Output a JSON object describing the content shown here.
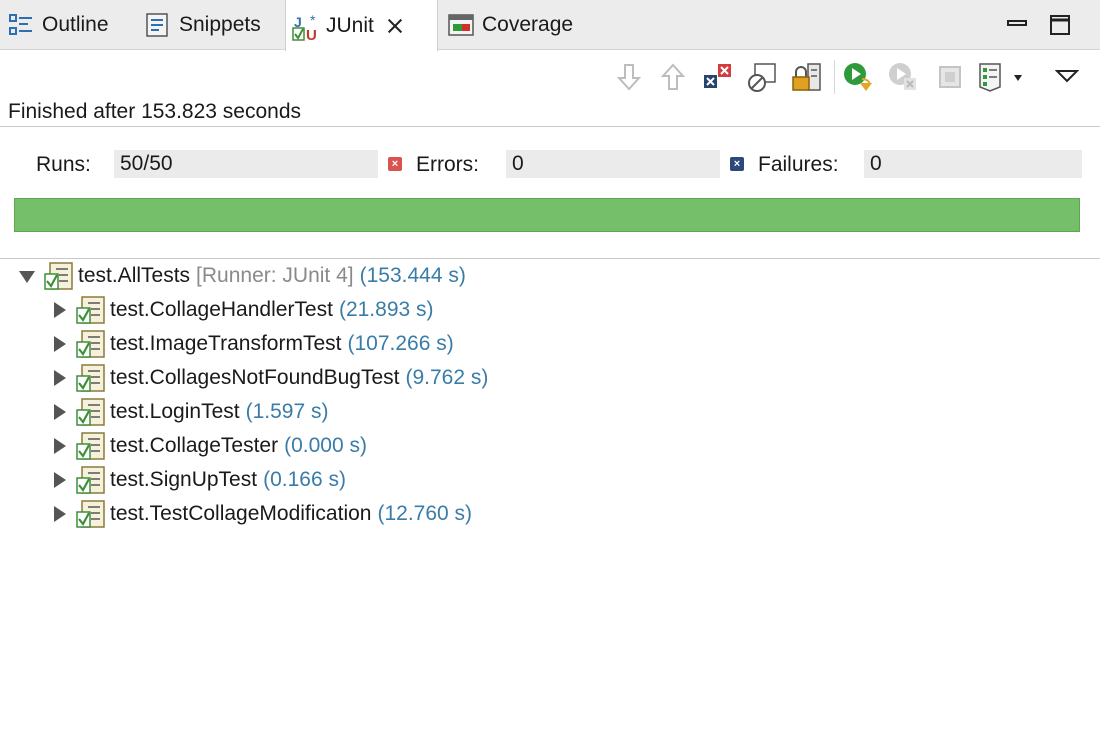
{
  "tabs": [
    {
      "label": "Outline",
      "icon": "outline-icon"
    },
    {
      "label": "Snippets",
      "icon": "snippets-icon"
    },
    {
      "label": "JUnit",
      "icon": "junit-icon",
      "active": true
    },
    {
      "label": "Coverage",
      "icon": "coverage-icon"
    }
  ],
  "window_controls": [
    "minimize-icon",
    "maximize-icon"
  ],
  "toolbar": [
    "next-failure-icon",
    "previous-failure-icon",
    "show-failures-only-icon",
    "show-skipped-only-icon",
    "scroll-lock-icon",
    "rerun-test-icon",
    "rerun-failed-first-icon",
    "stop-icon",
    "test-run-history-icon",
    "view-menu-icon"
  ],
  "status": "Finished after 153.823 seconds",
  "counters": {
    "runs_label": "Runs:",
    "runs_value": "50/50",
    "errors_label": "Errors:",
    "errors_value": "0",
    "failures_label": "Failures:",
    "failures_value": "0"
  },
  "colors": {
    "progress_ok": "#76bf6a",
    "time_text": "#3a7ca8",
    "error_marker": "#d9534f",
    "failure_marker": "#2b4a7a"
  },
  "progress": 1.0,
  "tree": {
    "root": {
      "name": "test.AllTests",
      "runner": "[Runner: JUnit 4]",
      "time": "(153.444 s)"
    },
    "children": [
      {
        "name": "test.CollageHandlerTest",
        "time": "(21.893 s)"
      },
      {
        "name": "test.ImageTransformTest",
        "time": "(107.266 s)"
      },
      {
        "name": "test.CollagesNotFoundBugTest",
        "time": "(9.762 s)"
      },
      {
        "name": "test.LoginTest",
        "time": "(1.597 s)"
      },
      {
        "name": "test.CollageTester",
        "time": "(0.000 s)"
      },
      {
        "name": "test.SignUpTest",
        "time": "(0.166 s)"
      },
      {
        "name": "test.TestCollageModification",
        "time": "(12.760 s)"
      }
    ]
  }
}
